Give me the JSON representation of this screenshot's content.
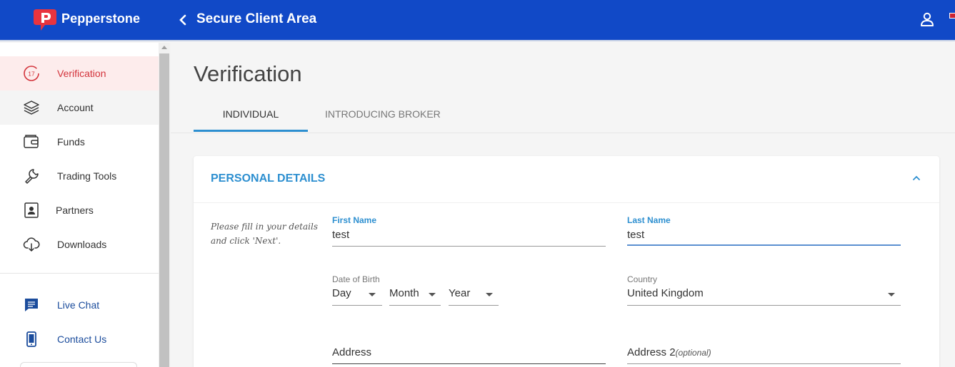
{
  "header": {
    "brand": "Pepperstone",
    "title": "Secure Client Area",
    "brand_color": "#1149c7"
  },
  "sidebar": {
    "items": [
      {
        "label": "Verification",
        "icon": "verification-badge-icon",
        "badge": "17",
        "state": "active"
      },
      {
        "label": "Account",
        "icon": "layers-icon"
      },
      {
        "label": "Funds",
        "icon": "wallet-icon"
      },
      {
        "label": "Trading Tools",
        "icon": "wrench-icon"
      },
      {
        "label": "Partners",
        "icon": "partner-card-icon"
      },
      {
        "label": "Downloads",
        "icon": "cloud-download-icon"
      }
    ],
    "help": [
      {
        "label": "Live Chat",
        "icon": "chat-icon"
      },
      {
        "label": "Contact Us",
        "icon": "phone-icon"
      }
    ]
  },
  "main": {
    "title": "Verification",
    "tabs": [
      {
        "label": "INDIVIDUAL",
        "active": true
      },
      {
        "label": "INTRODUCING BROKER",
        "active": false
      }
    ],
    "section": {
      "title": "PERSONAL DETAILS",
      "hint": "Please fill in your details and click 'Next'.",
      "fields": {
        "first_name": {
          "label": "First Name",
          "value": "test"
        },
        "last_name": {
          "label": "Last Name",
          "value": "test"
        },
        "dob": {
          "label": "Date of Birth",
          "day": "Day",
          "month": "Month",
          "year": "Year"
        },
        "country": {
          "label": "Country",
          "value": "United Kingdom"
        },
        "address": {
          "label": "Address"
        },
        "address2": {
          "label": "Address 2",
          "optional": "(optional)"
        }
      }
    },
    "accent_color": "#2d8fd0",
    "active_nav_color": "#d3333b"
  }
}
